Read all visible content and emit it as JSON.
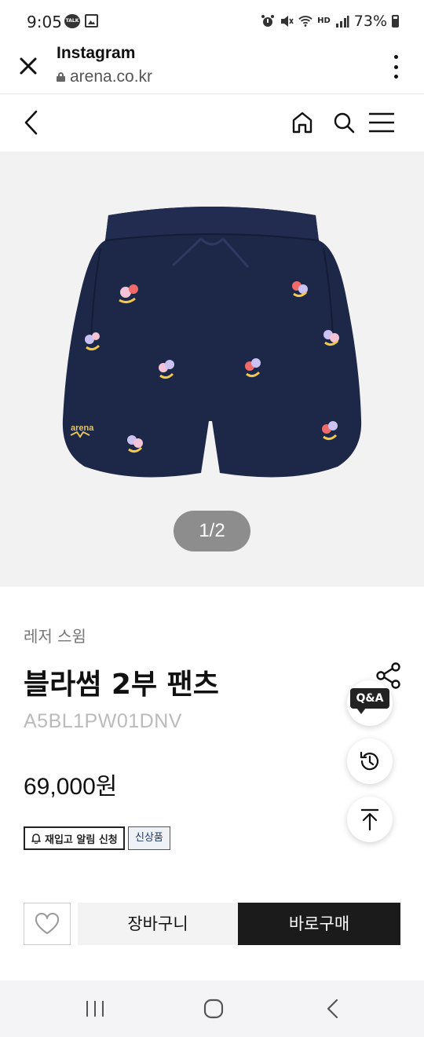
{
  "status_bar": {
    "time": "9:05",
    "battery": "73%",
    "left_icons": [
      "kakaotalk-icon",
      "image-icon"
    ],
    "right_icons": [
      "alarm-icon",
      "mute-icon",
      "wifi-icon",
      "hd-voice-icon",
      "signal-icon",
      "battery-icon"
    ],
    "talk_label": "TALK",
    "hd_label": "HD"
  },
  "browser": {
    "title": "Instagram",
    "url": "arena.co.kr"
  },
  "gallery": {
    "pager": "1/2"
  },
  "product": {
    "category": "레저 스윔",
    "name": "블라썸 2부 팬츠",
    "code": "A5BL1PW01DNV",
    "price": "69,000원",
    "tags": {
      "restock": "재입고 알림 신청",
      "new": "신상품"
    },
    "image_brand_text": "arena",
    "colors": {
      "navy": "#1d2747",
      "background": "#f2f2f2"
    }
  },
  "side_buttons": {
    "qa": "Q&A"
  },
  "actions": {
    "cart": "장바구니",
    "buy": "바로구매"
  }
}
